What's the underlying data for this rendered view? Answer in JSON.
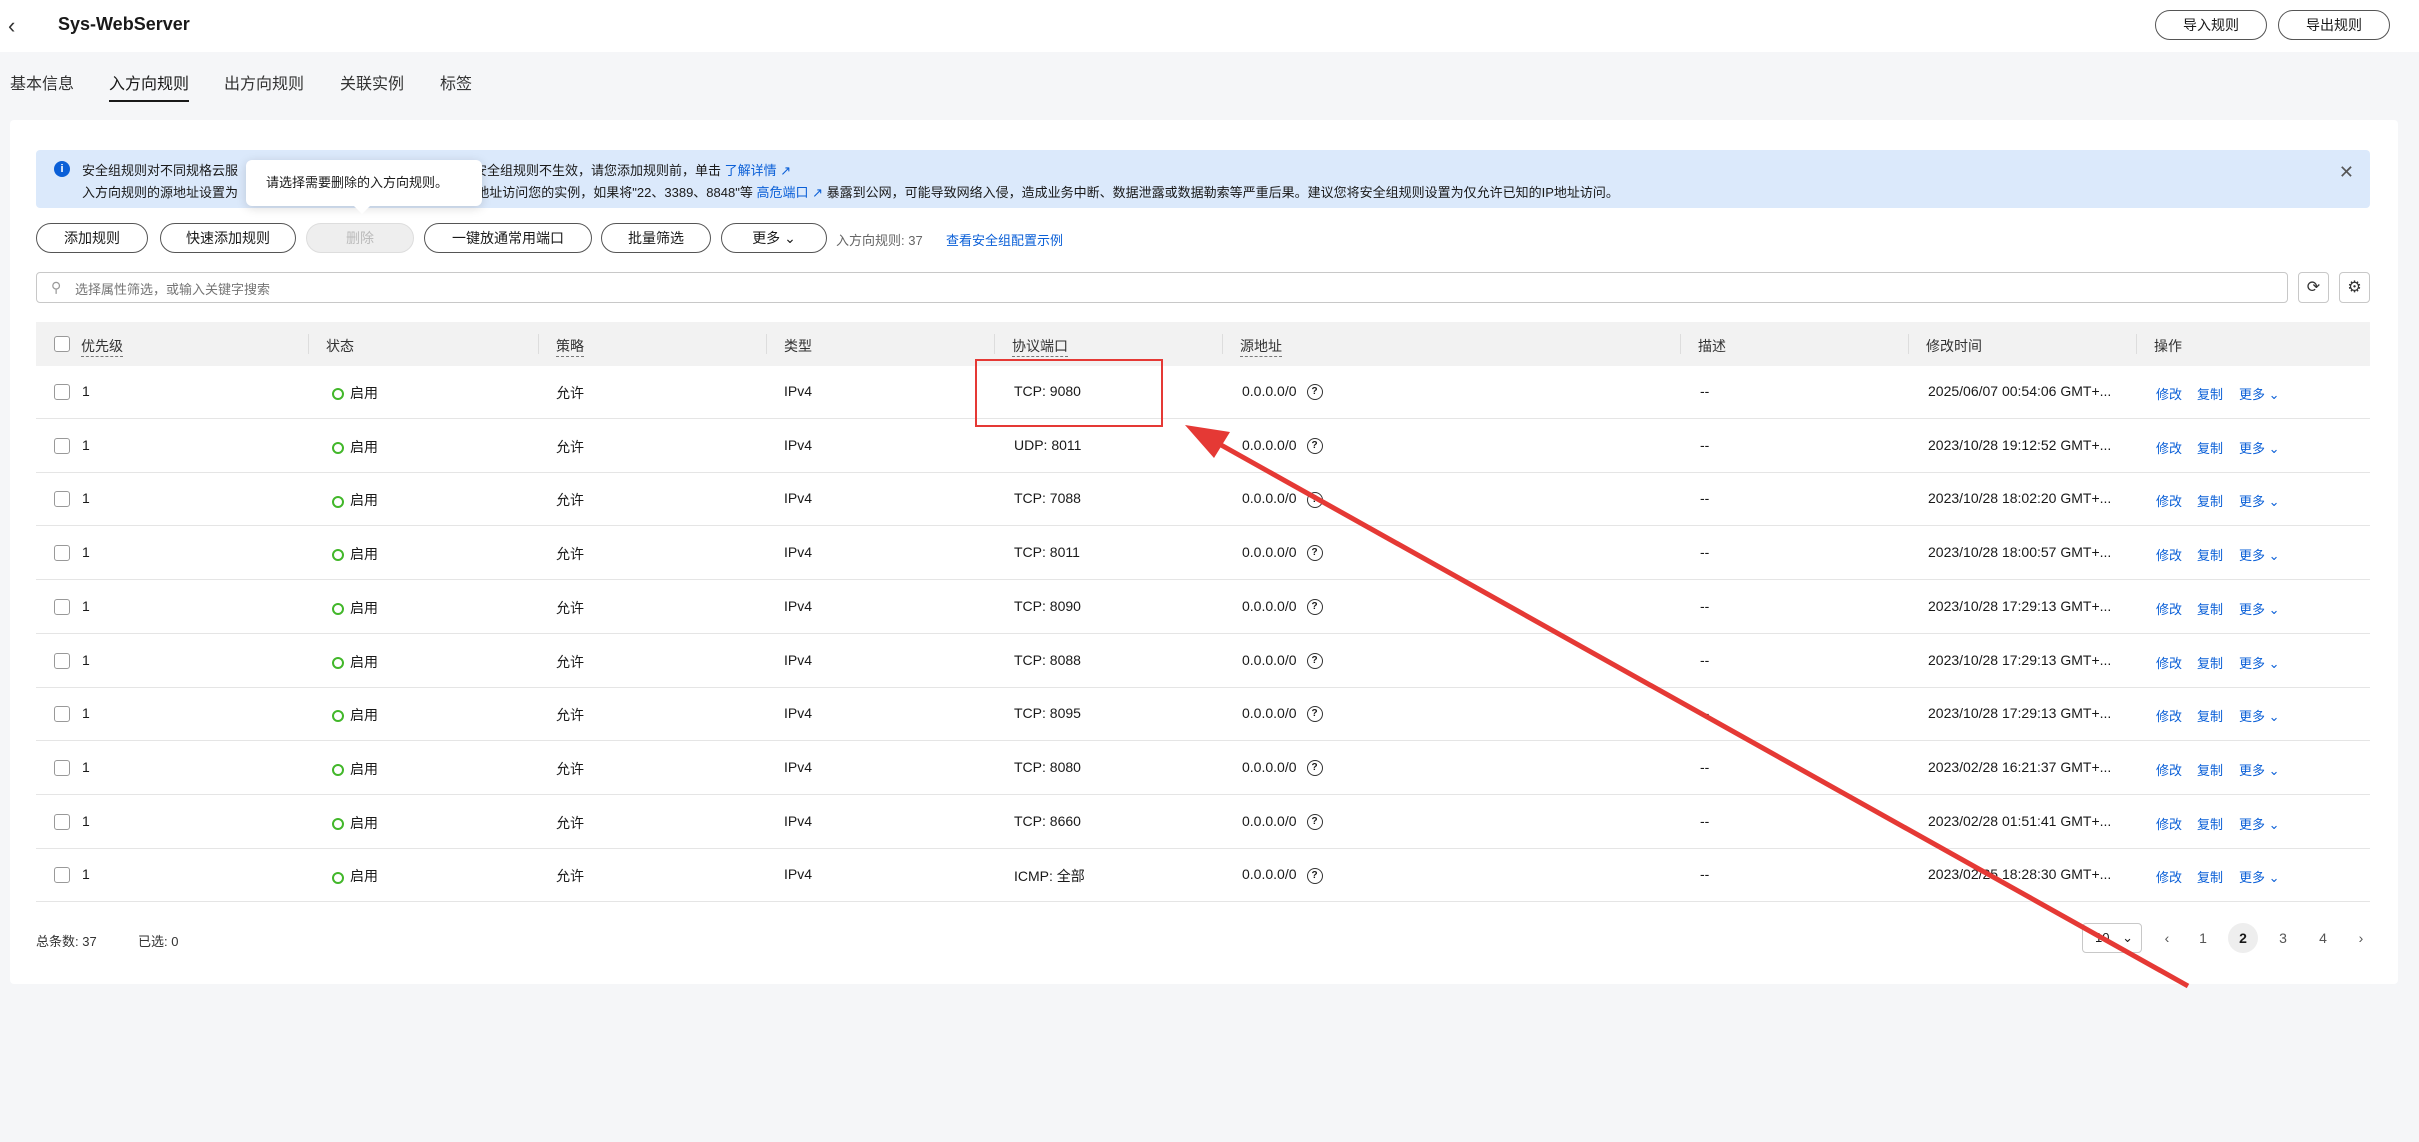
{
  "header": {
    "back_icon": "chevron-left-icon",
    "title": "Sys-WebServer",
    "import_label": "导入规则",
    "export_label": "导出规则"
  },
  "tabs": [
    "基本信息",
    "入方向规则",
    "出方向规则",
    "关联实例",
    "标签"
  ],
  "notice": {
    "line1_a": "安全组规则对不同规格云服",
    "line1_b": "安全组规则不生效，请您添加规则前，单击",
    "line1_link": "了解详情",
    "line2_a": "入方向规则的源地址设置为",
    "line2_b": "外部IP地址访问您的实例，如果将\"22、3389、8848\"等",
    "line2_link": "高危端口",
    "line2_c": "暴露到公网，可能导致网络入侵，造成业务中断、数据泄露或数据勒索等严重后果。建议您将安全组规则设置为仅允许已知的IP地址访问。"
  },
  "tooltip": "请选择需要删除的入方向规则。",
  "toolbar": {
    "add": "添加规则",
    "quick_add": "快速添加规则",
    "delete": "删除",
    "open_ports": "一键放通常用端口",
    "batch_filter": "批量筛选",
    "more": "更多",
    "count_label": "入方向规则: 37",
    "example_link": "查看安全组配置示例"
  },
  "search": {
    "placeholder": "选择属性筛选，或输入关键字搜索"
  },
  "columns": [
    "优先级",
    "状态",
    "策略",
    "类型",
    "协议端口",
    "源地址",
    "描述",
    "修改时间",
    "操作"
  ],
  "rows": [
    {
      "priority": "1",
      "status": "启用",
      "policy": "允许",
      "type": "IPv4",
      "port": "TCP: 9080",
      "source": "0.0.0.0/0",
      "desc": "--",
      "time": "2025/06/07 00:54:06 GMT+..."
    },
    {
      "priority": "1",
      "status": "启用",
      "policy": "允许",
      "type": "IPv4",
      "port": "UDP: 8011",
      "source": "0.0.0.0/0",
      "desc": "--",
      "time": "2023/10/28 19:12:52 GMT+..."
    },
    {
      "priority": "1",
      "status": "启用",
      "policy": "允许",
      "type": "IPv4",
      "port": "TCP: 7088",
      "source": "0.0.0.0/0",
      "desc": "--",
      "time": "2023/10/28 18:02:20 GMT+..."
    },
    {
      "priority": "1",
      "status": "启用",
      "policy": "允许",
      "type": "IPv4",
      "port": "TCP: 8011",
      "source": "0.0.0.0/0",
      "desc": "--",
      "time": "2023/10/28 18:00:57 GMT+..."
    },
    {
      "priority": "1",
      "status": "启用",
      "policy": "允许",
      "type": "IPv4",
      "port": "TCP: 8090",
      "source": "0.0.0.0/0",
      "desc": "--",
      "time": "2023/10/28 17:29:13 GMT+..."
    },
    {
      "priority": "1",
      "status": "启用",
      "policy": "允许",
      "type": "IPv4",
      "port": "TCP: 8088",
      "source": "0.0.0.0/0",
      "desc": "--",
      "time": "2023/10/28 17:29:13 GMT+..."
    },
    {
      "priority": "1",
      "status": "启用",
      "policy": "允许",
      "type": "IPv4",
      "port": "TCP: 8095",
      "source": "0.0.0.0/0",
      "desc": "--",
      "time": "2023/10/28 17:29:13 GMT+..."
    },
    {
      "priority": "1",
      "status": "启用",
      "policy": "允许",
      "type": "IPv4",
      "port": "TCP: 8080",
      "source": "0.0.0.0/0",
      "desc": "--",
      "time": "2023/02/28 16:21:37 GMT+..."
    },
    {
      "priority": "1",
      "status": "启用",
      "policy": "允许",
      "type": "IPv4",
      "port": "TCP: 8660",
      "source": "0.0.0.0/0",
      "desc": "--",
      "time": "2023/02/28 01:51:41 GMT+..."
    },
    {
      "priority": "1",
      "status": "启用",
      "policy": "允许",
      "type": "IPv4",
      "port": "ICMP: 全部",
      "source": "0.0.0.0/0",
      "desc": "--",
      "time": "2023/02/25 18:28:30 GMT+..."
    }
  ],
  "row_ops": {
    "edit": "修改",
    "copy": "复制",
    "more": "更多"
  },
  "footer": {
    "total": "总条数: 37",
    "selected": "已选: 0",
    "page_size": "10",
    "pages": [
      "1",
      "2",
      "3",
      "4"
    ]
  },
  "colors": {
    "accent": "#0a5fd7",
    "status_green": "#42b72a",
    "annotation_red": "#e53935"
  }
}
